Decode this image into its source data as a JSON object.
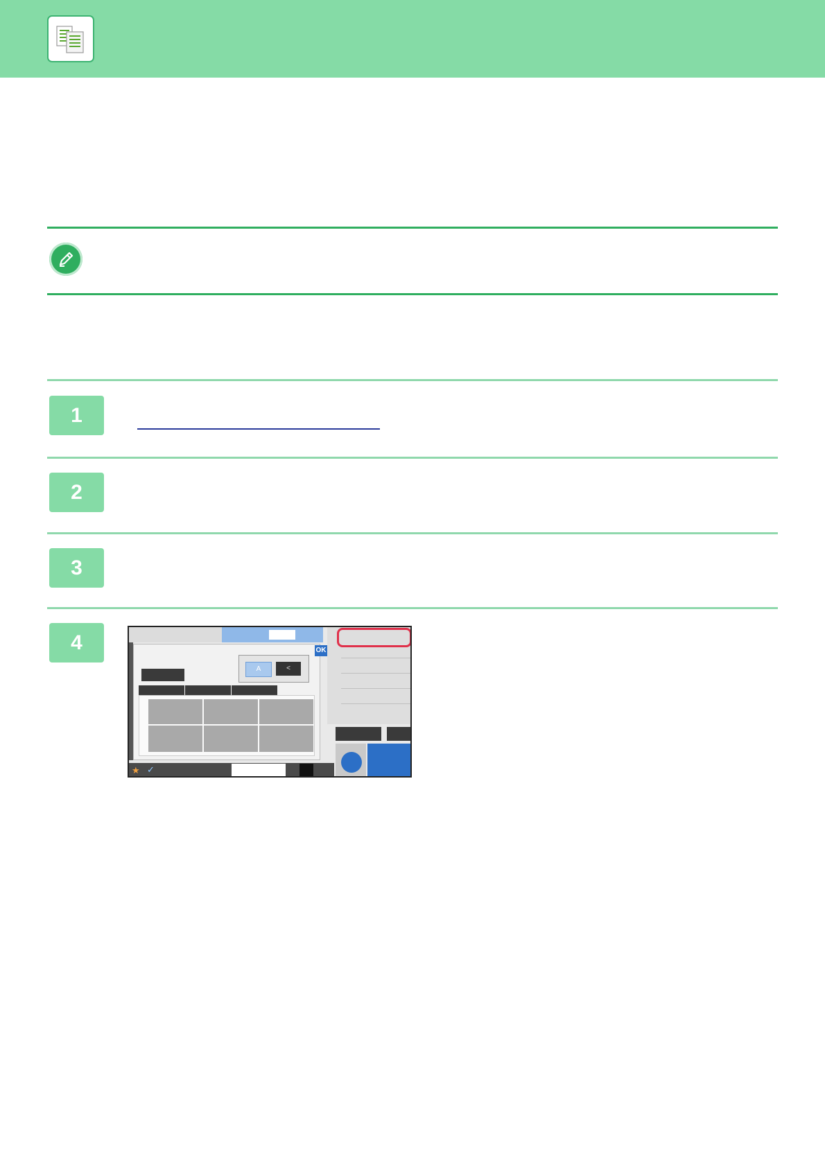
{
  "header": {
    "icon": "copy-icon",
    "accent": "#85dba6"
  },
  "note": {
    "icon": "pencil-icon",
    "rule_color": "#2fae5f"
  },
  "steps": [
    {
      "number": "1"
    },
    {
      "number": "2"
    },
    {
      "number": "3"
    },
    {
      "number": "4"
    }
  ],
  "panel": {
    "ok_label": "OK",
    "highlight_color": "#e0304a",
    "orientation_option_1": "A",
    "orientation_option_2": "<",
    "icons": [
      "star-icon",
      "check-icon",
      "start-icon",
      "color-start-icon"
    ]
  }
}
